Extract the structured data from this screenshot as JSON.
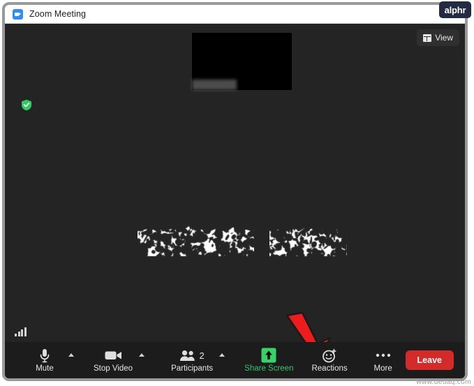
{
  "window": {
    "title": "Zoom Meeting",
    "app_icon": "zoom-camera-icon"
  },
  "branding": {
    "logo_text": "alphr",
    "logo_color": "#222b42",
    "site_watermark": "www.deuaq.com"
  },
  "stage": {
    "view_button": {
      "label": "View",
      "icon": "grid-layout-icon"
    },
    "encryption_badge": {
      "icon": "green-shield-check-icon",
      "color": "#2ecc5e"
    },
    "network_indicator": {
      "icon": "signal-bars-icon"
    },
    "thumbnail": {
      "name_label": ""
    },
    "participant_name": "",
    "annotation_arrow": {
      "icon": "red-down-arrow-icon",
      "color": "#ee1c1c"
    }
  },
  "toolbar": {
    "background": "#1c1c1c",
    "items": [
      {
        "label": "Mute",
        "icon": "microphone-icon",
        "has_caret": true
      },
      {
        "label": "Stop Video",
        "icon": "video-camera-icon",
        "has_caret": true
      },
      {
        "label": "Participants",
        "icon": "people-icon",
        "count": "2",
        "has_caret": true
      },
      {
        "label": "Share Screen",
        "icon": "share-screen-up-arrow-icon",
        "accent": "#36c76a",
        "has_caret": false
      },
      {
        "label": "Reactions",
        "icon": "smiley-plus-icon",
        "has_caret": false
      },
      {
        "label": "More",
        "icon": "ellipsis-icon",
        "has_caret": false
      }
    ],
    "leave_button": {
      "label": "Leave",
      "color": "#d32a2a"
    }
  }
}
